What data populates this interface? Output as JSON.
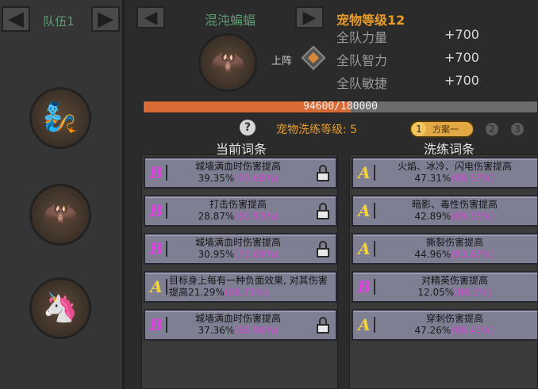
{
  "team": {
    "label": "队伍1",
    "prev_icon": "double-left-arrow-icon",
    "next_icon": "double-right-arrow-icon",
    "slots": [
      {
        "name": "genie-lamp-pet",
        "emoji": "🧞"
      },
      {
        "name": "chaos-bat-pet",
        "emoji": "🦇"
      },
      {
        "name": "unicorn-pet",
        "emoji": "🦄"
      }
    ]
  },
  "pet": {
    "name": "混沌蝙蝠",
    "emoji": "🦇",
    "deploy_label": "上阵",
    "level_label": "宠物等级12",
    "stats": [
      {
        "label": "全队力量",
        "value": "+700"
      },
      {
        "label": "全队智力",
        "value": "+700"
      },
      {
        "label": "全队敏捷",
        "value": "+700"
      }
    ]
  },
  "xp": {
    "text": "94600/180000",
    "fraction": 0.5256
  },
  "refine": {
    "help_glyph": "?",
    "level_label": "宠物洗练等级: 5",
    "plans": [
      {
        "num": "1",
        "label": "方案一",
        "active": true
      },
      {
        "num": "2"
      },
      {
        "num": "3"
      }
    ],
    "current_title": "当前词条",
    "refine_title": "洗练词条",
    "current": [
      {
        "grade": "B",
        "name": "城墙满血时伤害提高",
        "pct": "39.35%",
        "max": "(93.68%)"
      },
      {
        "grade": "B",
        "name": "打击伤害提高",
        "pct": "28.87%",
        "max": "(85.93%)"
      },
      {
        "grade": "B",
        "name": "城墙满血时伤害提高",
        "pct": "30.95%",
        "max": "(73.69%)"
      },
      {
        "grade": "A",
        "name": "目标身上每有一种负面效果, 对其伤害提高",
        "pct": "21.29%",
        "max": "(88.71%)"
      },
      {
        "grade": "B",
        "name": "城墙满血时伤害提高",
        "pct": "37.36%",
        "max": "(88.96%)"
      }
    ],
    "candidates": [
      {
        "grade": "A",
        "name": "火焰、冰冷、闪电伤害提高",
        "pct": "47.31%",
        "max": "(98.57%)"
      },
      {
        "grade": "A",
        "name": "暗影、毒性伤害提高",
        "pct": "42.89%",
        "max": "(89.35%)"
      },
      {
        "grade": "A",
        "name": "撕裂伤害提高",
        "pct": "44.96%",
        "max": "(93.67%)"
      },
      {
        "grade": "B",
        "name": "对精英伤害提高",
        "pct": "12.05%",
        "max": "(86.1%)"
      },
      {
        "grade": "A",
        "name": "穿刺伤害提高",
        "pct": "47.26%",
        "max": "(98.45%)"
      }
    ]
  },
  "colors": {
    "xp_fill": "#d86a35",
    "grade_B": "#e040e0",
    "grade_A": "#f2d23a",
    "accent_orange": "#e89c2a",
    "name_green": "#5f9b73"
  }
}
